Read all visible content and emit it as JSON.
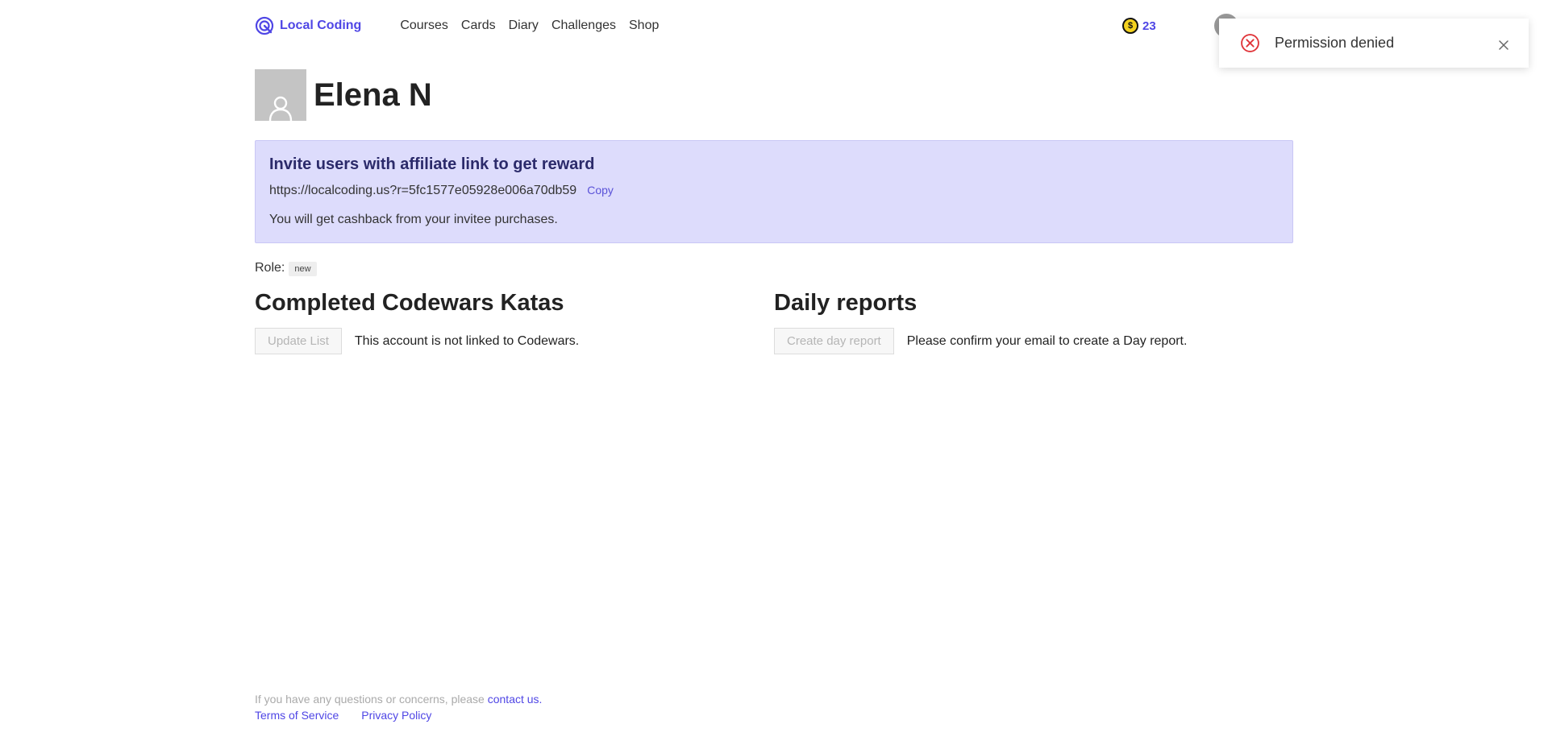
{
  "header": {
    "logo_text": "Local Coding",
    "nav": [
      "Courses",
      "Cards",
      "Diary",
      "Challenges",
      "Shop"
    ],
    "coin_icon_text": "$",
    "coins": "23"
  },
  "toast": {
    "message": "Permission denied",
    "error_color": "#e0353a"
  },
  "profile": {
    "name": "Elena N"
  },
  "affiliate": {
    "title": "Invite users with affiliate link to get reward",
    "link": "https://localcoding.us?r=5fc1577e05928e006a70db59",
    "copy_label": "Copy",
    "note": "You will get cashback from your invitee purchases."
  },
  "role": {
    "label": "Role:",
    "value": "new"
  },
  "katas": {
    "title": "Completed Codewars Katas",
    "button": "Update List",
    "message": "This account is not linked to Codewars."
  },
  "reports": {
    "title": "Daily reports",
    "button": "Create day report",
    "message": "Please confirm your email to create a Day report."
  },
  "footer": {
    "question": "If you have any questions or concerns, please",
    "contact": "contact us.",
    "terms": "Terms of Service",
    "privacy": "Privacy Policy"
  },
  "colors": {
    "brand": "#4f46e5",
    "affiliate_bg": "#dddcfc"
  }
}
